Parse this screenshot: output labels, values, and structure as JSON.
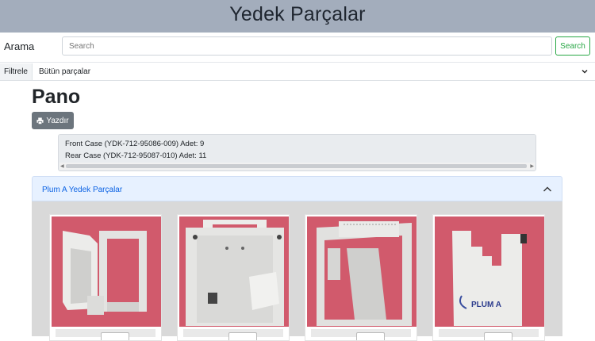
{
  "header": {
    "title": "Yedek Parçalar"
  },
  "search": {
    "label": "Arama",
    "placeholder": "Search",
    "button": "Search"
  },
  "filter": {
    "label": "Filtrele",
    "selected": "Bütün parçalar"
  },
  "page": {
    "title": "Pano",
    "print_label": "Yazdır"
  },
  "summary": {
    "lines": [
      "Front Case (YDK-712-95086-009) Adet: 9",
      "Rear Case (YDK-712-95087-010) Adet: 11"
    ]
  },
  "accordion": {
    "title": "Plum A Yedek Parçalar"
  },
  "products": [
    {
      "image_icon": "front-case-part-photo"
    },
    {
      "image_icon": "rear-case-part-photo"
    },
    {
      "image_icon": "frame-part-photo"
    },
    {
      "image_icon": "door-part-photo",
      "image_text": "PLUM A"
    }
  ],
  "colors": {
    "header_bg": "#a3adbc",
    "search_button": "#28a745",
    "print_button": "#6c757d",
    "accordion_header": "#e7f1ff",
    "accordion_title": "#0c63e4",
    "photo_bg": "#d15a6c"
  }
}
